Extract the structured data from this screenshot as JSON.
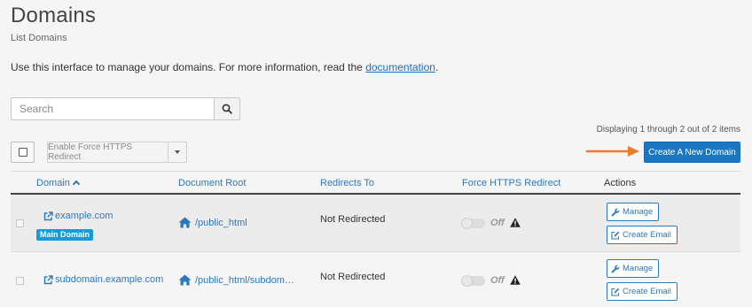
{
  "header": {
    "title": "Domains",
    "subtitle": "List Domains"
  },
  "intro": {
    "text": "Use this interface to manage your domains. For more information, read the ",
    "link": "documentation",
    "suffix": "."
  },
  "search": {
    "placeholder": "Search",
    "value": ""
  },
  "pagination": {
    "displaying": "Displaying 1 through 2 out of 2 items"
  },
  "toolbar": {
    "force_https_label": "Enable Force HTTPS Redirect",
    "create_label": "Create A New Domain"
  },
  "table": {
    "columns": {
      "domain": "Domain",
      "document_root": "Document Root",
      "redirects_to": "Redirects To",
      "force_https": "Force HTTPS Redirect",
      "actions": "Actions"
    },
    "rows": [
      {
        "domain": "example.com",
        "badge": "Main Domain",
        "document_root": "/public_html",
        "redirects_to": "Not Redirected",
        "force_https": "Off",
        "manage_label": "Manage",
        "create_email_label": "Create Email"
      },
      {
        "domain": "subdomain.example.com",
        "document_root": "/public_html/subdom…",
        "redirects_to": "Not Redirected",
        "force_https": "Off",
        "manage_label": "Manage",
        "create_email_label": "Create Email"
      }
    ]
  },
  "colors": {
    "link": "#2f78b8",
    "primary_button": "#1c77c3",
    "badge": "#1a9ad6",
    "arrow": "#f07a2b"
  },
  "icons": [
    "search-icon",
    "sort-ascending-icon",
    "external-link-icon",
    "home-icon",
    "warning-icon",
    "wrench-icon",
    "edit-icon",
    "arrow-icon"
  ]
}
